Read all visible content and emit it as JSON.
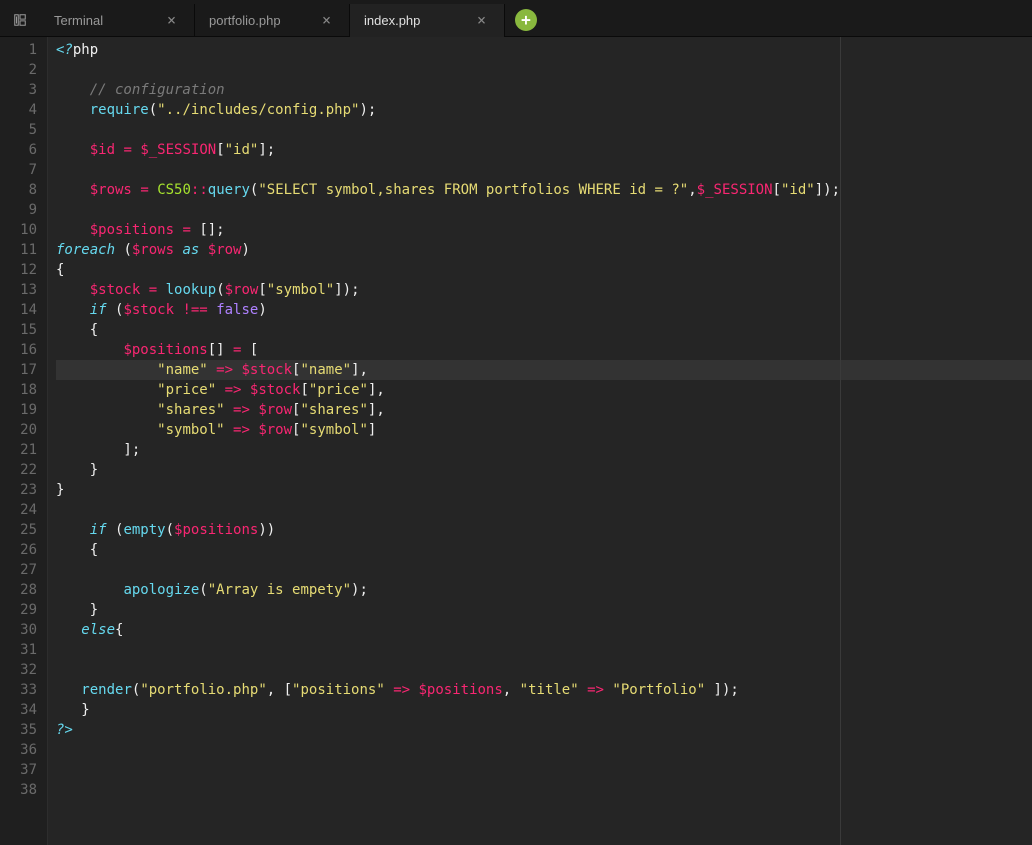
{
  "tabs": [
    {
      "label": "Terminal",
      "active": false
    },
    {
      "label": "portfolio.php",
      "active": false
    },
    {
      "label": "index.php",
      "active": true
    }
  ],
  "addTab": "+",
  "lineNumbers": [
    "1",
    "2",
    "3",
    "4",
    "5",
    "6",
    "7",
    "8",
    "9",
    "10",
    "11",
    "12",
    "13",
    "14",
    "15",
    "16",
    "17",
    "18",
    "19",
    "20",
    "21",
    "22",
    "23",
    "24",
    "25",
    "26",
    "27",
    "28",
    "29",
    "30",
    "31",
    "32",
    "33",
    "34",
    "35",
    "36",
    "37",
    "38"
  ],
  "highlightLine": 17,
  "code": [
    [
      [
        "<?",
        "tok-keyword"
      ],
      [
        "php",
        "tok-default"
      ]
    ],
    [],
    [
      [
        "    ",
        "tok-default"
      ],
      [
        "// configuration",
        "tok-comment"
      ]
    ],
    [
      [
        "    ",
        "tok-default"
      ],
      [
        "require",
        "tok-func"
      ],
      [
        "(",
        "tok-punc"
      ],
      [
        "\"../includes/config.php\"",
        "tok-string"
      ],
      [
        ")",
        "tok-punc"
      ],
      [
        ";",
        "tok-punc"
      ]
    ],
    [],
    [
      [
        "    ",
        "tok-default"
      ],
      [
        "$id",
        "tok-var"
      ],
      [
        " ",
        "tok-default"
      ],
      [
        "=",
        "tok-op"
      ],
      [
        " ",
        "tok-default"
      ],
      [
        "$_SESSION",
        "tok-var"
      ],
      [
        "[",
        "tok-punc"
      ],
      [
        "\"id\"",
        "tok-string"
      ],
      [
        "]",
        "tok-punc"
      ],
      [
        ";",
        "tok-punc"
      ]
    ],
    [],
    [
      [
        "    ",
        "tok-default"
      ],
      [
        "$rows",
        "tok-var"
      ],
      [
        " ",
        "tok-default"
      ],
      [
        "=",
        "tok-op"
      ],
      [
        " ",
        "tok-default"
      ],
      [
        "CS50",
        "tok-class"
      ],
      [
        "::",
        "tok-op"
      ],
      [
        "query",
        "tok-func"
      ],
      [
        "(",
        "tok-punc"
      ],
      [
        "\"SELECT symbol,shares FROM portfolios WHERE id = ?\"",
        "tok-string"
      ],
      [
        ",",
        "tok-punc"
      ],
      [
        "$_SESSION",
        "tok-var"
      ],
      [
        "[",
        "tok-punc"
      ],
      [
        "\"id\"",
        "tok-string"
      ],
      [
        "]",
        "tok-punc"
      ],
      [
        ")",
        "tok-punc"
      ],
      [
        ";",
        "tok-punc"
      ]
    ],
    [],
    [
      [
        "    ",
        "tok-default"
      ],
      [
        "$positions",
        "tok-var"
      ],
      [
        " ",
        "tok-default"
      ],
      [
        "=",
        "tok-op"
      ],
      [
        " [];",
        "tok-punc"
      ]
    ],
    [
      [
        "foreach",
        "tok-keyword"
      ],
      [
        " (",
        "tok-punc"
      ],
      [
        "$rows",
        "tok-var"
      ],
      [
        " ",
        "tok-default"
      ],
      [
        "as",
        "tok-keyword"
      ],
      [
        " ",
        "tok-default"
      ],
      [
        "$row",
        "tok-var"
      ],
      [
        ")",
        "tok-punc"
      ]
    ],
    [
      [
        "{",
        "tok-punc"
      ]
    ],
    [
      [
        "    ",
        "tok-default"
      ],
      [
        "$stock",
        "tok-var"
      ],
      [
        " ",
        "tok-default"
      ],
      [
        "=",
        "tok-op"
      ],
      [
        " ",
        "tok-default"
      ],
      [
        "lookup",
        "tok-func"
      ],
      [
        "(",
        "tok-punc"
      ],
      [
        "$row",
        "tok-var"
      ],
      [
        "[",
        "tok-punc"
      ],
      [
        "\"symbol\"",
        "tok-string"
      ],
      [
        "]",
        "tok-punc"
      ],
      [
        ")",
        "tok-punc"
      ],
      [
        ";",
        "tok-punc"
      ]
    ],
    [
      [
        "    ",
        "tok-default"
      ],
      [
        "if",
        "tok-keyword"
      ],
      [
        " (",
        "tok-punc"
      ],
      [
        "$stock",
        "tok-var"
      ],
      [
        " ",
        "tok-default"
      ],
      [
        "!==",
        "tok-op"
      ],
      [
        " ",
        "tok-default"
      ],
      [
        "false",
        "tok-const"
      ],
      [
        ")",
        "tok-punc"
      ]
    ],
    [
      [
        "    {",
        "tok-punc"
      ]
    ],
    [
      [
        "        ",
        "tok-default"
      ],
      [
        "$positions",
        "tok-var"
      ],
      [
        "[] ",
        "tok-punc"
      ],
      [
        "=",
        "tok-op"
      ],
      [
        " [",
        "tok-punc"
      ]
    ],
    [
      [
        "            ",
        "tok-default"
      ],
      [
        "\"name\"",
        "tok-string"
      ],
      [
        " ",
        "tok-default"
      ],
      [
        "=>",
        "tok-op"
      ],
      [
        " ",
        "tok-default"
      ],
      [
        "$stock",
        "tok-var"
      ],
      [
        "[",
        "tok-punc"
      ],
      [
        "\"name\"",
        "tok-string"
      ],
      [
        "]",
        "tok-punc"
      ],
      [
        ",",
        "tok-punc"
      ]
    ],
    [
      [
        "            ",
        "tok-default"
      ],
      [
        "\"price\"",
        "tok-string"
      ],
      [
        " ",
        "tok-default"
      ],
      [
        "=>",
        "tok-op"
      ],
      [
        " ",
        "tok-default"
      ],
      [
        "$stock",
        "tok-var"
      ],
      [
        "[",
        "tok-punc"
      ],
      [
        "\"price\"",
        "tok-string"
      ],
      [
        "]",
        "tok-punc"
      ],
      [
        ",",
        "tok-punc"
      ]
    ],
    [
      [
        "            ",
        "tok-default"
      ],
      [
        "\"shares\"",
        "tok-string"
      ],
      [
        " ",
        "tok-default"
      ],
      [
        "=>",
        "tok-op"
      ],
      [
        " ",
        "tok-default"
      ],
      [
        "$row",
        "tok-var"
      ],
      [
        "[",
        "tok-punc"
      ],
      [
        "\"shares\"",
        "tok-string"
      ],
      [
        "]",
        "tok-punc"
      ],
      [
        ",",
        "tok-punc"
      ]
    ],
    [
      [
        "            ",
        "tok-default"
      ],
      [
        "\"symbol\"",
        "tok-string"
      ],
      [
        " ",
        "tok-default"
      ],
      [
        "=>",
        "tok-op"
      ],
      [
        " ",
        "tok-default"
      ],
      [
        "$row",
        "tok-var"
      ],
      [
        "[",
        "tok-punc"
      ],
      [
        "\"symbol\"",
        "tok-string"
      ],
      [
        "]",
        "tok-punc"
      ]
    ],
    [
      [
        "        ];",
        "tok-punc"
      ]
    ],
    [
      [
        "    }",
        "tok-punc"
      ]
    ],
    [
      [
        "}",
        "tok-punc"
      ]
    ],
    [],
    [
      [
        "    ",
        "tok-default"
      ],
      [
        "if",
        "tok-keyword"
      ],
      [
        " (",
        "tok-punc"
      ],
      [
        "empty",
        "tok-func"
      ],
      [
        "(",
        "tok-punc"
      ],
      [
        "$positions",
        "tok-var"
      ],
      [
        "))",
        "tok-punc"
      ]
    ],
    [
      [
        "    {",
        "tok-punc"
      ]
    ],
    [],
    [
      [
        "        ",
        "tok-default"
      ],
      [
        "apologize",
        "tok-func"
      ],
      [
        "(",
        "tok-punc"
      ],
      [
        "\"Array is empety\"",
        "tok-string"
      ],
      [
        ")",
        "tok-punc"
      ],
      [
        ";",
        "tok-punc"
      ]
    ],
    [
      [
        "    }",
        "tok-punc"
      ]
    ],
    [
      [
        "   ",
        "tok-default"
      ],
      [
        "else",
        "tok-keyword"
      ],
      [
        "{",
        "tok-punc"
      ]
    ],
    [],
    [],
    [
      [
        "   ",
        "tok-default"
      ],
      [
        "render",
        "tok-func"
      ],
      [
        "(",
        "tok-punc"
      ],
      [
        "\"portfolio.php\"",
        "tok-string"
      ],
      [
        ", [",
        "tok-punc"
      ],
      [
        "\"positions\"",
        "tok-string"
      ],
      [
        " ",
        "tok-default"
      ],
      [
        "=>",
        "tok-op"
      ],
      [
        " ",
        "tok-default"
      ],
      [
        "$positions",
        "tok-var"
      ],
      [
        ", ",
        "tok-punc"
      ],
      [
        "\"title\"",
        "tok-string"
      ],
      [
        " ",
        "tok-default"
      ],
      [
        "=>",
        "tok-op"
      ],
      [
        " ",
        "tok-default"
      ],
      [
        "\"Portfolio\"",
        "tok-string"
      ],
      [
        " ])",
        "tok-punc"
      ],
      [
        ";",
        "tok-punc"
      ]
    ],
    [
      [
        "   }",
        "tok-punc"
      ]
    ],
    [
      [
        "?>",
        "tok-keyword"
      ]
    ],
    [],
    [],
    []
  ]
}
